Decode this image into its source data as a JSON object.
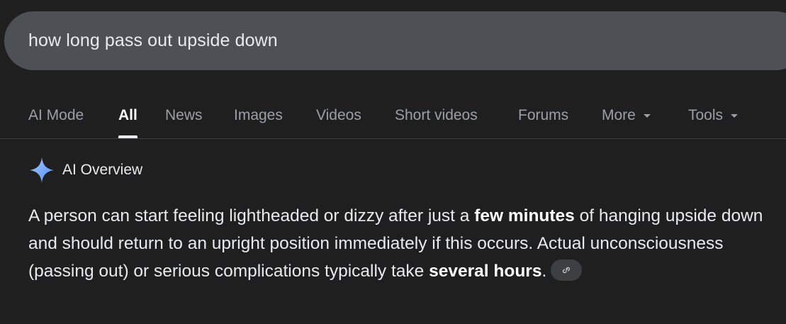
{
  "search": {
    "query": "how long pass out upside down"
  },
  "tabs": [
    {
      "label": "AI Mode"
    },
    {
      "label": "All",
      "active": true
    },
    {
      "label": "News"
    },
    {
      "label": "Images"
    },
    {
      "label": "Videos"
    },
    {
      "label": "Short videos"
    },
    {
      "label": "Forums"
    },
    {
      "label": "More"
    },
    {
      "label": "Tools"
    }
  ],
  "ai_overview": {
    "title": "AI Overview",
    "text_1": "A person can start feeling lightheaded or dizzy after just a ",
    "bold_1": "few minutes",
    "text_2": " of hanging upside down and should return to an upright position immediately if this occurs. Actual unconsciousness (passing out) or serious complications typically take ",
    "bold_2": "several hours",
    "text_3": ".",
    "link_icon": "link-icon"
  },
  "colors": {
    "background": "#1f1f1f",
    "search_bar": "#4d5156",
    "tab_inactive": "#9aa0a6",
    "tab_active": "#ffffff",
    "sparkle_blue": "#8ab4f8"
  }
}
